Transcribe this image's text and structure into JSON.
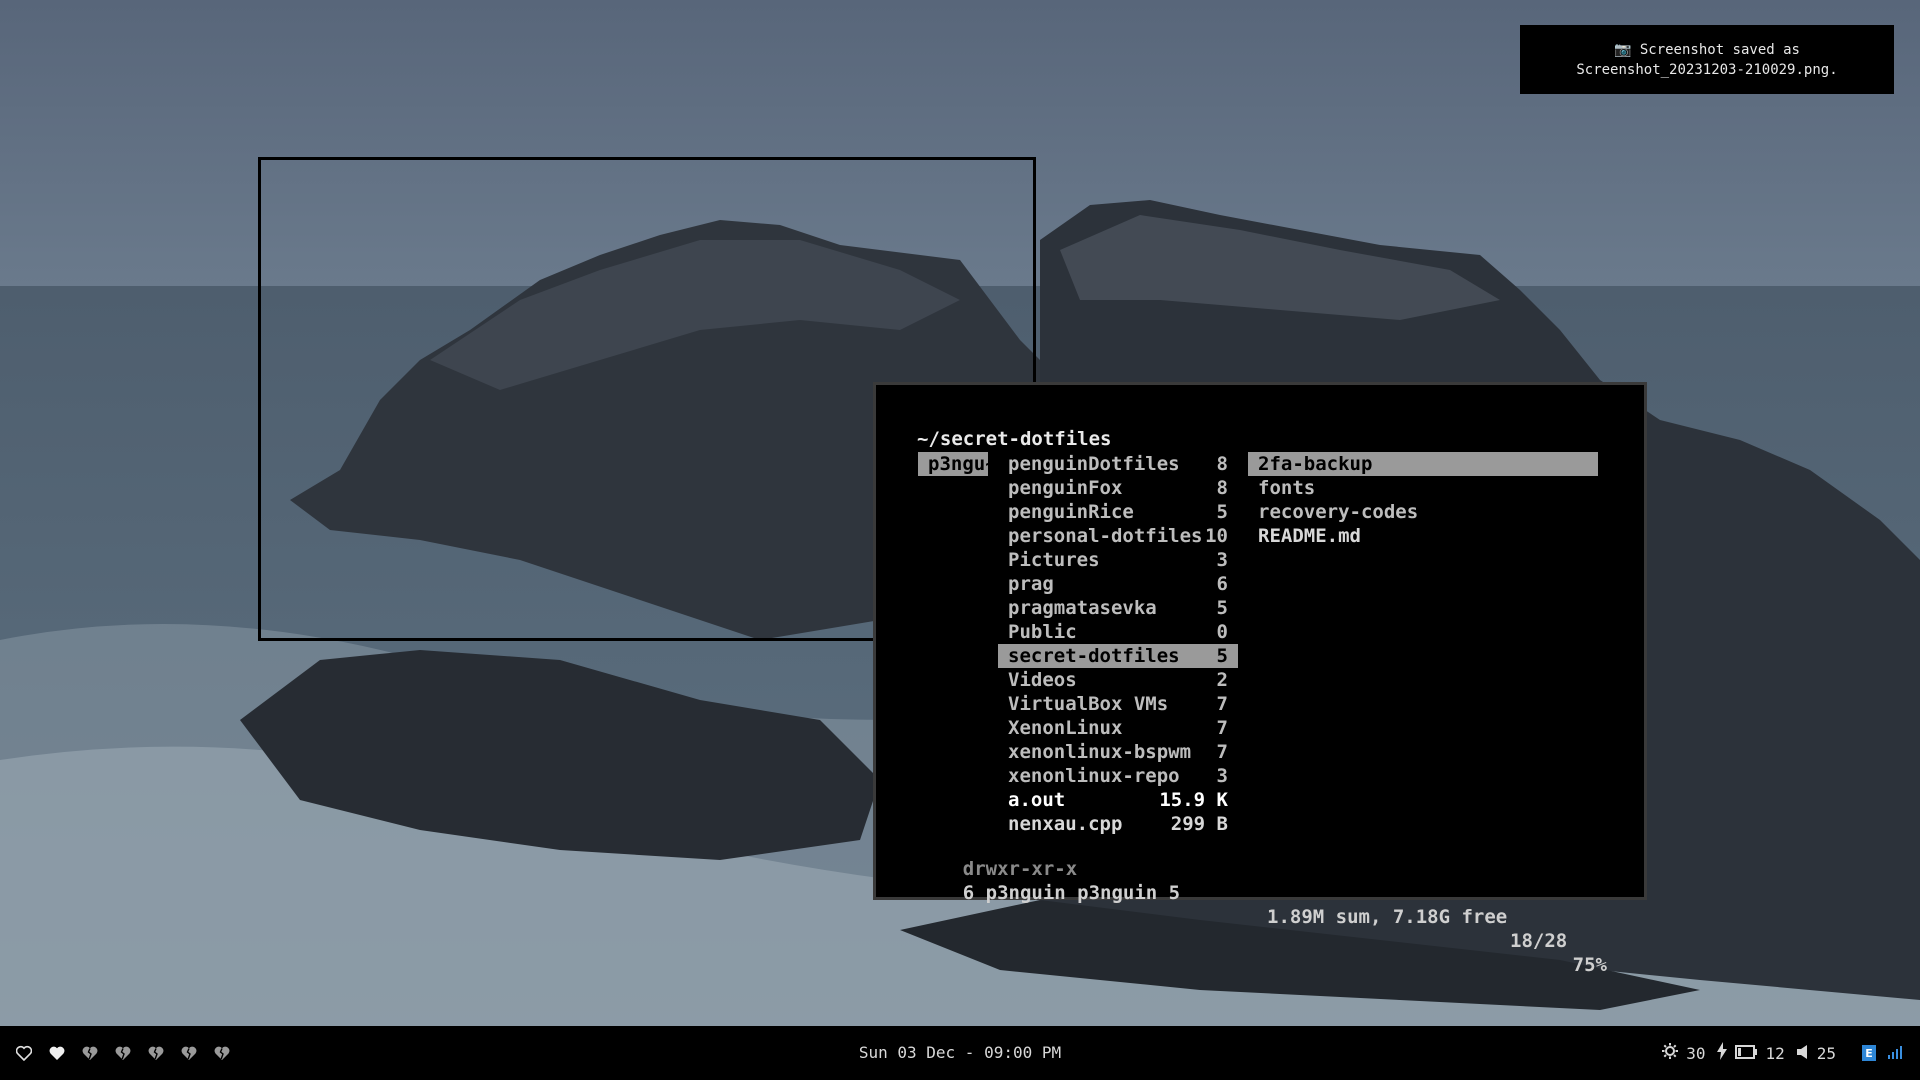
{
  "notification": {
    "icon": "camera-icon",
    "line1": "📷 Screenshot saved as",
    "line2": "Screenshot_20231203-210029.png."
  },
  "terminal": {
    "path": "~/secret-dotfiles",
    "user_tag": "p3ngu~",
    "middle_column": [
      {
        "name": "penguinDotfiles",
        "count": "8",
        "type": "dir"
      },
      {
        "name": "penguinFox",
        "count": "8",
        "type": "dir"
      },
      {
        "name": "penguinRice",
        "count": "5",
        "type": "dir"
      },
      {
        "name": "personal-dotfiles",
        "count": "10",
        "type": "dir"
      },
      {
        "name": "Pictures",
        "count": "3",
        "type": "dir"
      },
      {
        "name": "prag",
        "count": "6",
        "type": "dir"
      },
      {
        "name": "pragmatasevka",
        "count": "5",
        "type": "dir"
      },
      {
        "name": "Public",
        "count": "0",
        "type": "dir"
      },
      {
        "name": "secret-dotfiles",
        "count": "5",
        "type": "dir",
        "selected": true
      },
      {
        "name": "Videos",
        "count": "2",
        "type": "dir"
      },
      {
        "name": "VirtualBox VMs",
        "count": "7",
        "type": "dir"
      },
      {
        "name": "XenonLinux",
        "count": "7",
        "type": "dir"
      },
      {
        "name": "xenonlinux-bspwm",
        "count": "7",
        "type": "dir"
      },
      {
        "name": "xenonlinux-repo",
        "count": "3",
        "type": "dir"
      },
      {
        "name": "a.out",
        "count": "15.9 K",
        "type": "exec"
      },
      {
        "name": "nenxau.cpp",
        "count": "299 B",
        "type": "file"
      }
    ],
    "right_column": [
      {
        "name": "2fa-backup",
        "selected": true
      },
      {
        "name": "fonts"
      },
      {
        "name": "recovery-codes"
      },
      {
        "name": "README.md",
        "type": "file"
      }
    ],
    "status": {
      "permissions": "drwxr-xr-x",
      "owner_info": "6 p3nguin p3nguin 5",
      "disk": "1.89M sum, 7.18G free",
      "position": "18/28",
      "percent": "75%"
    }
  },
  "bar": {
    "workspaces": [
      {
        "icon": "heart-outline-icon",
        "state": "empty"
      },
      {
        "icon": "heart-filled-icon",
        "state": "active"
      },
      {
        "icon": "heart-broken-icon",
        "state": "inactive"
      },
      {
        "icon": "heart-broken-icon",
        "state": "inactive"
      },
      {
        "icon": "heart-broken-icon",
        "state": "inactive"
      },
      {
        "icon": "heart-broken-icon",
        "state": "inactive"
      },
      {
        "icon": "heart-broken-icon",
        "state": "inactive"
      }
    ],
    "clock": "Sun 03 Dec - 09:00 PM",
    "brightness": "30",
    "battery": "12",
    "volume": "25",
    "tray_badge": "E"
  }
}
